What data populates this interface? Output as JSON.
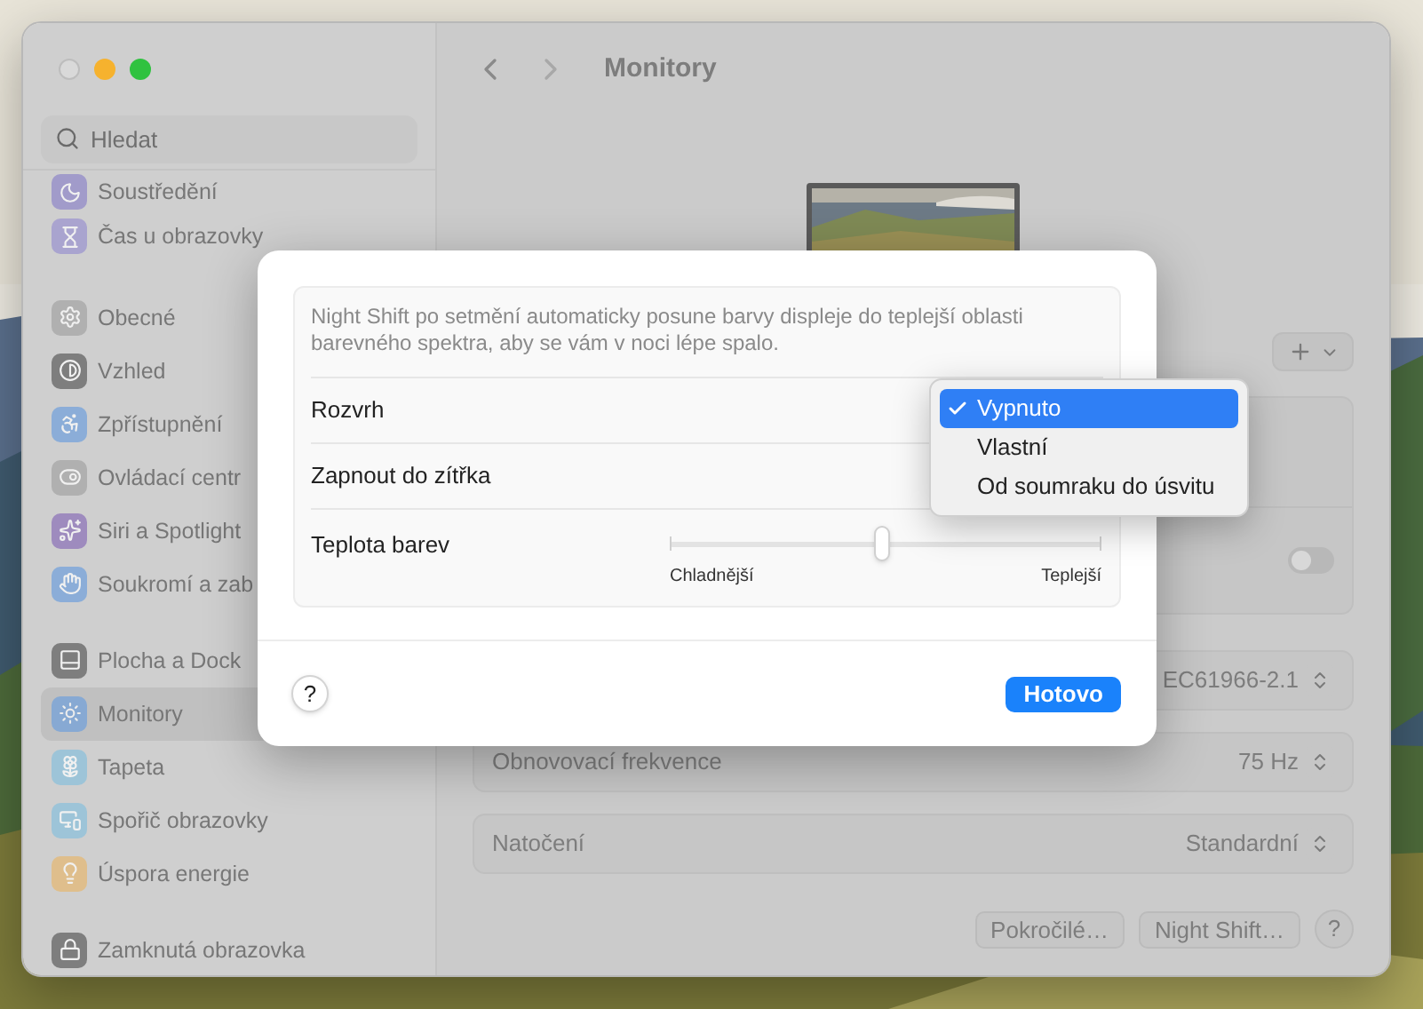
{
  "sidebar": {
    "search": {
      "placeholder": "Hledat"
    },
    "groups": [
      {
        "items": [
          {
            "label": "Soustředění",
            "selected": false
          },
          {
            "label": "Čas u obrazovky",
            "selected": false
          }
        ]
      },
      {
        "items": [
          {
            "label": "Obecné",
            "selected": false
          },
          {
            "label": "Vzhled",
            "selected": false
          },
          {
            "label": "Zpřístupnění",
            "selected": false
          },
          {
            "label": "Ovládací centr",
            "selected": false
          },
          {
            "label": "Siri a Spotlight",
            "selected": false
          },
          {
            "label": "Soukromí a zab",
            "selected": false
          }
        ]
      },
      {
        "items": [
          {
            "label": "Plocha a Dock",
            "selected": false
          },
          {
            "label": "Monitory",
            "selected": true
          },
          {
            "label": "Tapeta",
            "selected": false
          },
          {
            "label": "Spořič obrazovky",
            "selected": false
          },
          {
            "label": "Úspora energie",
            "selected": false
          }
        ]
      },
      {
        "items": [
          {
            "label": "Zamknutá obrazovka",
            "selected": false
          }
        ]
      }
    ]
  },
  "main": {
    "title": "Monitory",
    "toggle": {
      "on": false
    },
    "rows": [
      {
        "label": "",
        "value": "EC61966-2.1"
      },
      {
        "label": "Obnovovací frekvence",
        "value": "75 Hz"
      },
      {
        "label": "Natočení",
        "value": "Standardní"
      }
    ],
    "buttons": [
      "Pokročilé…",
      "Night Shift…"
    ],
    "help": "?"
  },
  "sheet": {
    "description": "Night Shift po setmění automaticky posune barvy displeje do teplejší oblasti barevného spektra, aby se vám v noci lépe spalo.",
    "schedule_label": "Rozvrh",
    "until_tomorrow_label": "Zapnout do zítřka",
    "temperature": {
      "label": "Teplota barev",
      "level": 0.49,
      "min_label": "Chladnější",
      "max_label": "Teplejší"
    },
    "help": "?",
    "done": "Hotovo"
  },
  "menu": {
    "items": [
      {
        "label": "Vypnuto",
        "selected": true
      },
      {
        "label": "Vlastní",
        "selected": false
      },
      {
        "label": "Od soumraku do úsvitu",
        "selected": false
      }
    ]
  }
}
